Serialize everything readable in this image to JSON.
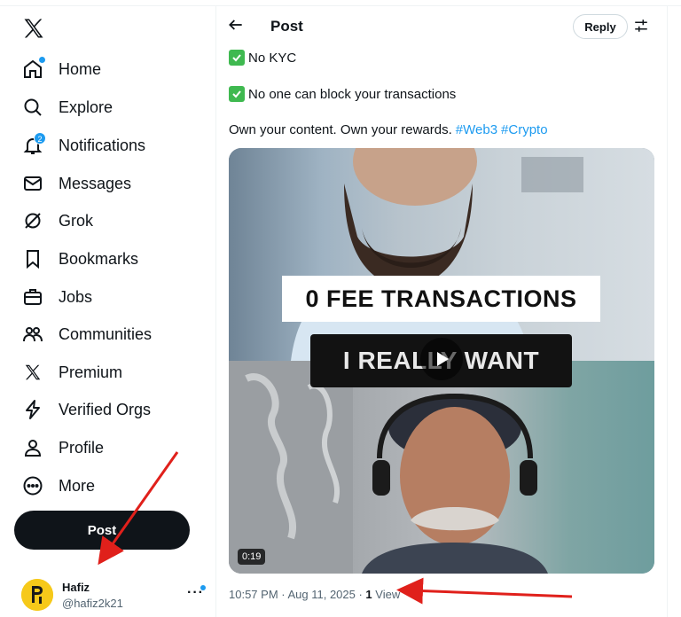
{
  "sidebar": {
    "logo_icon": "x-logo-icon",
    "items": [
      {
        "label": "Home",
        "icon": "home-icon"
      },
      {
        "label": "Explore",
        "icon": "search-icon"
      },
      {
        "label": "Notifications",
        "icon": "bell-icon",
        "badge": "2"
      },
      {
        "label": "Messages",
        "icon": "envelope-icon"
      },
      {
        "label": "Grok",
        "icon": "grok-icon"
      },
      {
        "label": "Bookmarks",
        "icon": "bookmark-icon"
      },
      {
        "label": "Jobs",
        "icon": "briefcase-icon"
      },
      {
        "label": "Communities",
        "icon": "people-icon"
      },
      {
        "label": "Premium",
        "icon": "x-logo-icon"
      },
      {
        "label": "Verified Orgs",
        "icon": "lightning-icon"
      },
      {
        "label": "Profile",
        "icon": "person-icon"
      },
      {
        "label": "More",
        "icon": "more-circle-icon"
      }
    ],
    "post_label": "Post"
  },
  "account": {
    "name": "Hafiz",
    "handle": "@hafiz2k21",
    "more": "···"
  },
  "header": {
    "title": "Post",
    "reply_label": "Reply"
  },
  "post": {
    "line1": "No KYC",
    "line2": "No one can block your transactions",
    "line3": "Own your content. Own your rewards.",
    "hashtags": [
      "#Web3",
      "#Crypto"
    ],
    "video": {
      "caption_top": "0 FEE TRANSACTIONS",
      "caption_bottom": "I REALLY WANT",
      "duration": "0:19"
    },
    "time": "10:57 PM · Aug 11, 2025 · ",
    "views_count": "1",
    "views_label": " View"
  },
  "colors": {
    "accent": "#1d9bf0",
    "text": "#0f1419",
    "muted": "#536471",
    "check": "#3fb950",
    "annotation_arrow": "#e0201b"
  }
}
